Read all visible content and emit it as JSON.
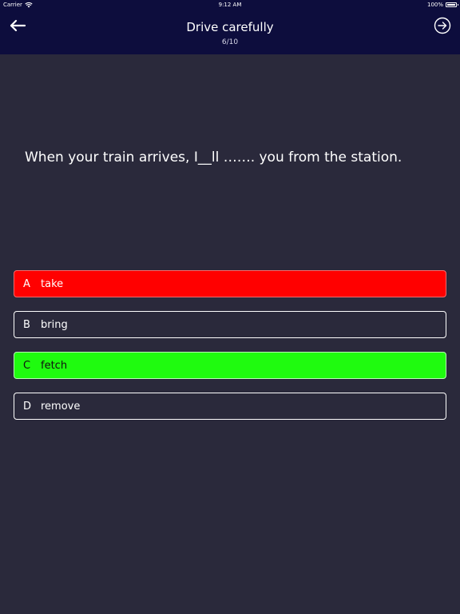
{
  "status_bar": {
    "carrier": "Carrier",
    "time": "9:12 AM",
    "battery": "100%"
  },
  "header": {
    "title": "Drive carefully",
    "progress": "6/10",
    "back_icon": "arrow-left-icon",
    "next_icon": "arrow-right-circle-icon"
  },
  "question": {
    "text": "When your train arrives, I__ll ……. you from the station."
  },
  "options": [
    {
      "letter": "A",
      "text": "take",
      "state": "wrong"
    },
    {
      "letter": "B",
      "text": "bring",
      "state": "neutral"
    },
    {
      "letter": "C",
      "text": "fetch",
      "state": "correct"
    },
    {
      "letter": "D",
      "text": "remove",
      "state": "neutral"
    }
  ],
  "colors": {
    "header_bg": "#0d0d3d",
    "page_bg": "#2a293b",
    "wrong": "#ff0000",
    "correct": "#1ffb0f"
  }
}
